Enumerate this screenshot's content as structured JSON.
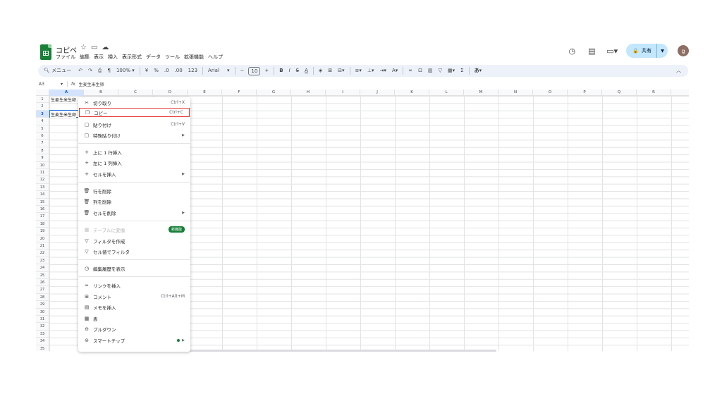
{
  "header": {
    "title": "コピペ",
    "menus": [
      "ファイル",
      "編集",
      "表示",
      "挿入",
      "表示形式",
      "データ",
      "ツール",
      "拡張機能",
      "ヘルプ"
    ],
    "share_label": "共有",
    "avatar_letter": "g"
  },
  "toolbar": {
    "search_label": "メニュー",
    "zoom": "100%",
    "currency": "¥",
    "percent": "%",
    "dec_decrease": ".0",
    "dec_increase": ".00",
    "number_format": "123",
    "font": "Arial",
    "font_size": "10"
  },
  "formula_bar": {
    "cell_ref": "A3",
    "fx": "fx",
    "value": "生麦生米生卵"
  },
  "grid": {
    "columns": [
      "A",
      "B",
      "C",
      "D",
      "E",
      "F",
      "G",
      "H",
      "I",
      "J",
      "K",
      "L",
      "M",
      "N",
      "O",
      "P",
      "Q",
      "R"
    ],
    "rows": [
      "1",
      "2",
      "3",
      "4",
      "5",
      "6",
      "7",
      "8",
      "9",
      "10",
      "11",
      "12",
      "13",
      "14",
      "15",
      "16",
      "17",
      "18",
      "19",
      "20",
      "21",
      "22",
      "23",
      "24",
      "25",
      "26",
      "27",
      "28",
      "29",
      "30",
      "31",
      "32",
      "33",
      "34",
      "35"
    ],
    "cells": {
      "A1": "生麦生米生卵",
      "A3": "生麦生米生卵"
    }
  },
  "context_menu": {
    "items": [
      {
        "label": "切り取り",
        "shortcut": "Ctrl+X",
        "icon": "scissors-icon"
      },
      {
        "label": "コピー",
        "shortcut": "Ctrl+C",
        "icon": "copy-icon"
      },
      {
        "label": "貼り付け",
        "shortcut": "Ctrl+V",
        "icon": "paste-icon"
      },
      {
        "label": "特殊貼り付け",
        "icon": "paste-special-icon"
      },
      {
        "label": "上に 1 行挿入",
        "icon": "plus-icon"
      },
      {
        "label": "左に 1 列挿入",
        "icon": "plus-icon"
      },
      {
        "label": "セルを挿入",
        "icon": "plus-icon"
      },
      {
        "label": "行を削除",
        "icon": "trash-icon"
      },
      {
        "label": "列を削除",
        "icon": "trash-icon"
      },
      {
        "label": "セルを削除",
        "icon": "trash-icon"
      },
      {
        "label": "テーブルに変換",
        "badge": "新機能",
        "icon": "table-convert-icon"
      },
      {
        "label": "フィルタを作成",
        "icon": "filter-icon"
      },
      {
        "label": "セル値でフィルタ",
        "icon": "filter-icon"
      },
      {
        "label": "編集履歴を表示",
        "icon": "history-icon"
      },
      {
        "label": "リンクを挿入",
        "icon": "link-icon"
      },
      {
        "label": "コメント",
        "shortcut": "Ctrl+Alt+M",
        "icon": "comment-icon"
      },
      {
        "label": "メモを挿入",
        "icon": "note-icon"
      },
      {
        "label": "表",
        "icon": "table-icon"
      },
      {
        "label": "プルダウン",
        "icon": "dropdown-icon"
      },
      {
        "label": "スマートチップ",
        "icon": "smart-chip-icon"
      }
    ]
  },
  "colors": {
    "accent": "#1a73e8",
    "share_bg": "#c2e7ff",
    "logo": "#188038",
    "highlight_border": "#e53935"
  }
}
